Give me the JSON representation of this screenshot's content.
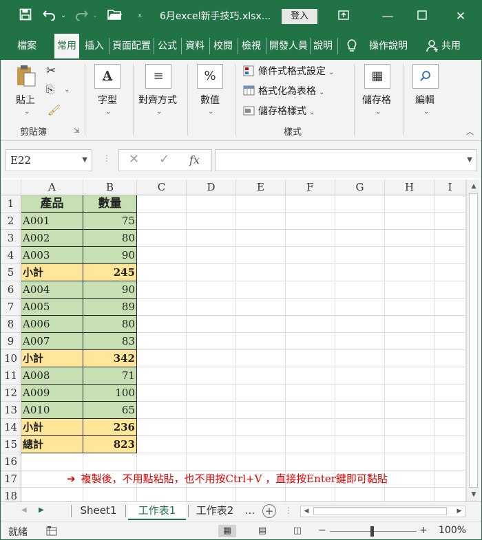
{
  "window": {
    "title": "6月excel新手技巧.xlsx...",
    "login": "登入",
    "colors": {
      "excel_green": "#217346",
      "green_fill": "#c6e0b4",
      "yellow_fill": "#ffe699",
      "note_red": "#e00000"
    }
  },
  "titlebar_icons": [
    "save-icon",
    "undo-icon",
    "redo-icon",
    "open-folder-icon",
    "customize-qat-icon"
  ],
  "tabs": [
    "檔案",
    "常用",
    "插入",
    "頁面配置",
    "公式",
    "資料",
    "校閱",
    "檢視",
    "開發人員",
    "說明",
    "操作說明",
    "共用"
  ],
  "active_tab": "常用",
  "ribbon": {
    "clipboard": {
      "paste": "貼上",
      "group": "剪貼簿"
    },
    "font": {
      "label": "字型"
    },
    "alignment": {
      "label": "對齊方式"
    },
    "number": {
      "label": "數值"
    },
    "styles": {
      "conditional": "條件式格式設定",
      "as_table": "格式化為表格",
      "cell_styles": "儲存格樣式",
      "group": "樣式"
    },
    "cells": {
      "label": "儲存格"
    },
    "editing": {
      "label": "編輯"
    }
  },
  "formula_bar": {
    "name_box": "E22",
    "fx": "fx",
    "value": ""
  },
  "columns": [
    "A",
    "B",
    "C",
    "D",
    "E",
    "F",
    "G",
    "H",
    "I"
  ],
  "rows": [
    {
      "n": "1",
      "a": "產品",
      "b": "數量",
      "style": "header"
    },
    {
      "n": "2",
      "a": "A001",
      "b": "75",
      "style": "data"
    },
    {
      "n": "3",
      "a": "A002",
      "b": "80",
      "style": "data"
    },
    {
      "n": "4",
      "a": "A003",
      "b": "90",
      "style": "data"
    },
    {
      "n": "5",
      "a": "小計",
      "b": "245",
      "style": "subtotal"
    },
    {
      "n": "6",
      "a": "A004",
      "b": "90",
      "style": "data"
    },
    {
      "n": "7",
      "a": "A005",
      "b": "89",
      "style": "data"
    },
    {
      "n": "8",
      "a": "A006",
      "b": "80",
      "style": "data"
    },
    {
      "n": "9",
      "a": "A007",
      "b": "83",
      "style": "data"
    },
    {
      "n": "10",
      "a": "小計",
      "b": "342",
      "style": "subtotal"
    },
    {
      "n": "11",
      "a": "A008",
      "b": "71",
      "style": "data"
    },
    {
      "n": "12",
      "a": "A009",
      "b": "100",
      "style": "data"
    },
    {
      "n": "13",
      "a": "A010",
      "b": "65",
      "style": "data"
    },
    {
      "n": "14",
      "a": "小計",
      "b": "236",
      "style": "subtotal"
    },
    {
      "n": "15",
      "a": "總計",
      "b": "823",
      "style": "subtotal"
    },
    {
      "n": "16",
      "a": "",
      "b": "",
      "style": "empty"
    },
    {
      "n": "17",
      "a": "",
      "b": "",
      "style": "empty"
    },
    {
      "n": "18",
      "a": "",
      "b": "",
      "style": "empty"
    }
  ],
  "note": {
    "arrow": "➔",
    "text": "複製後，不用點粘貼，也不用按Ctrl+V ，直接按Enter鍵即可黏貼"
  },
  "sheets": [
    "Sheet1",
    "工作表1",
    "工作表2"
  ],
  "active_sheet": "工作表1",
  "sheet_more": "...",
  "status": {
    "ready": "就緒",
    "zoom": "100%",
    "zoom_minus": "−",
    "zoom_plus": "+"
  }
}
